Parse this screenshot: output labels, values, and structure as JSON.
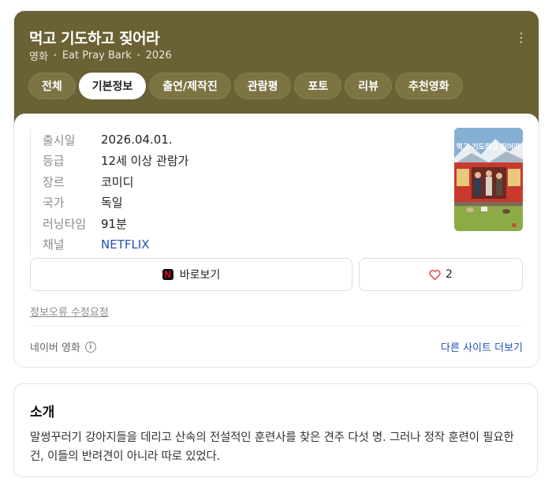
{
  "header": {
    "title": "먹고 기도하고 짖어라",
    "meta": [
      "영화",
      "Eat Pray Bark",
      "2026"
    ],
    "menu_icon": "more-vertical-icon"
  },
  "tabs": [
    {
      "label": "전체",
      "active": false
    },
    {
      "label": "기본정보",
      "active": true
    },
    {
      "label": "출연/제작진",
      "active": false
    },
    {
      "label": "관람평",
      "active": false
    },
    {
      "label": "포토",
      "active": false
    },
    {
      "label": "리뷰",
      "active": false
    },
    {
      "label": "추천영화",
      "active": false
    }
  ],
  "info": {
    "rows": [
      {
        "key": "출시일",
        "value": "2026.04.01."
      },
      {
        "key": "등급",
        "value": "12세 이상 관람가"
      },
      {
        "key": "장르",
        "value": "코미디"
      },
      {
        "key": "국가",
        "value": "독일"
      },
      {
        "key": "러닝타임",
        "value": "91분"
      },
      {
        "key": "채널",
        "value": "NETFLIX"
      }
    ]
  },
  "poster": {
    "title_text": "먹고 기도하고 짖어라",
    "badge": "N"
  },
  "actions": {
    "watch_icon": "N",
    "watch_label": "바로보기",
    "like_count": "2"
  },
  "report_label": "정보오류 수정요청",
  "source": {
    "label": "네이버 영화",
    "info_icon": "i"
  },
  "more_label": "다른 사이트 더보기",
  "intro": {
    "title": "소개",
    "text": "말썽꾸러기 강아지들을 데리고 산속의 전설적인 훈련사를 찾은 견주 다섯 명. 그러나 정작 훈련이 필요한 건, 이들의 반려견이 아니라 따로 있었다."
  },
  "colors": {
    "header_bg": "#6a6234",
    "link": "#2251b4",
    "netflix_red": "#e50914"
  }
}
